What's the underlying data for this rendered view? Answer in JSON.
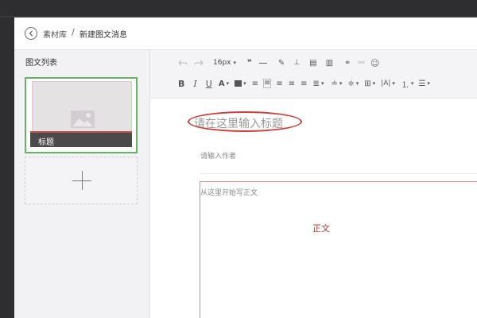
{
  "breadcrumb": {
    "back_icon": "chevron-left-circle-icon",
    "library": "素材库",
    "separator": "/",
    "current": "新建图文消息"
  },
  "sidebar": {
    "title": "图文列表",
    "articles": [
      {
        "title": "标题",
        "thumbnail_icon": "image-placeholder-icon"
      }
    ],
    "add_icon": "plus-icon"
  },
  "toolbar": {
    "font_size": "16px",
    "row1_icons": [
      "undo-icon",
      "redo-icon",
      "font-size-select",
      "blockquote-icon",
      "horizontal-rule-icon",
      "format-brush-icon",
      "clear-format-icon",
      "insert-template-icon",
      "paste-plain-icon",
      "link-icon",
      "unlink-icon",
      "emoji-icon"
    ],
    "row2_icons": [
      "bold-icon",
      "italic-icon",
      "underline-icon",
      "font-color-icon",
      "background-color-icon",
      "indent-icon",
      "align-left-icon",
      "align-center-icon",
      "align-right-icon",
      "align-justify-icon",
      "paragraph-spacing-before-icon",
      "paragraph-spacing-after-icon",
      "line-height-icon",
      "letter-spacing-icon",
      "ordered-list-icon",
      "unordered-list-icon"
    ]
  },
  "editor": {
    "title_placeholder": "请在这里输入标题",
    "author_placeholder": "请输入作者",
    "body_placeholder": "从这里开始写正文",
    "body_annotation": "正文",
    "highlight_color": "#c8403c"
  },
  "colors": {
    "selected_border": "#66b366",
    "accent_red": "#c84b4b",
    "card_bar": "#4a4a4a"
  }
}
